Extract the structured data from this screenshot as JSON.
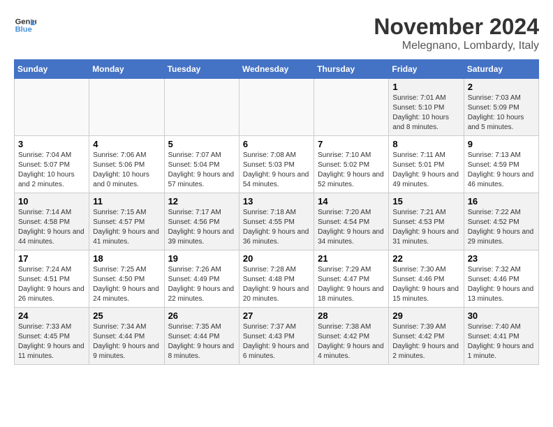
{
  "logo": {
    "line1": "General",
    "line2": "Blue"
  },
  "title": "November 2024",
  "location": "Melegnano, Lombardy, Italy",
  "weekdays": [
    "Sunday",
    "Monday",
    "Tuesday",
    "Wednesday",
    "Thursday",
    "Friday",
    "Saturday"
  ],
  "weeks": [
    [
      {
        "day": "",
        "info": ""
      },
      {
        "day": "",
        "info": ""
      },
      {
        "day": "",
        "info": ""
      },
      {
        "day": "",
        "info": ""
      },
      {
        "day": "",
        "info": ""
      },
      {
        "day": "1",
        "info": "Sunrise: 7:01 AM\nSunset: 5:10 PM\nDaylight: 10 hours and 8 minutes."
      },
      {
        "day": "2",
        "info": "Sunrise: 7:03 AM\nSunset: 5:09 PM\nDaylight: 10 hours and 5 minutes."
      }
    ],
    [
      {
        "day": "3",
        "info": "Sunrise: 7:04 AM\nSunset: 5:07 PM\nDaylight: 10 hours and 2 minutes."
      },
      {
        "day": "4",
        "info": "Sunrise: 7:06 AM\nSunset: 5:06 PM\nDaylight: 10 hours and 0 minutes."
      },
      {
        "day": "5",
        "info": "Sunrise: 7:07 AM\nSunset: 5:04 PM\nDaylight: 9 hours and 57 minutes."
      },
      {
        "day": "6",
        "info": "Sunrise: 7:08 AM\nSunset: 5:03 PM\nDaylight: 9 hours and 54 minutes."
      },
      {
        "day": "7",
        "info": "Sunrise: 7:10 AM\nSunset: 5:02 PM\nDaylight: 9 hours and 52 minutes."
      },
      {
        "day": "8",
        "info": "Sunrise: 7:11 AM\nSunset: 5:01 PM\nDaylight: 9 hours and 49 minutes."
      },
      {
        "day": "9",
        "info": "Sunrise: 7:13 AM\nSunset: 4:59 PM\nDaylight: 9 hours and 46 minutes."
      }
    ],
    [
      {
        "day": "10",
        "info": "Sunrise: 7:14 AM\nSunset: 4:58 PM\nDaylight: 9 hours and 44 minutes."
      },
      {
        "day": "11",
        "info": "Sunrise: 7:15 AM\nSunset: 4:57 PM\nDaylight: 9 hours and 41 minutes."
      },
      {
        "day": "12",
        "info": "Sunrise: 7:17 AM\nSunset: 4:56 PM\nDaylight: 9 hours and 39 minutes."
      },
      {
        "day": "13",
        "info": "Sunrise: 7:18 AM\nSunset: 4:55 PM\nDaylight: 9 hours and 36 minutes."
      },
      {
        "day": "14",
        "info": "Sunrise: 7:20 AM\nSunset: 4:54 PM\nDaylight: 9 hours and 34 minutes."
      },
      {
        "day": "15",
        "info": "Sunrise: 7:21 AM\nSunset: 4:53 PM\nDaylight: 9 hours and 31 minutes."
      },
      {
        "day": "16",
        "info": "Sunrise: 7:22 AM\nSunset: 4:52 PM\nDaylight: 9 hours and 29 minutes."
      }
    ],
    [
      {
        "day": "17",
        "info": "Sunrise: 7:24 AM\nSunset: 4:51 PM\nDaylight: 9 hours and 26 minutes."
      },
      {
        "day": "18",
        "info": "Sunrise: 7:25 AM\nSunset: 4:50 PM\nDaylight: 9 hours and 24 minutes."
      },
      {
        "day": "19",
        "info": "Sunrise: 7:26 AM\nSunset: 4:49 PM\nDaylight: 9 hours and 22 minutes."
      },
      {
        "day": "20",
        "info": "Sunrise: 7:28 AM\nSunset: 4:48 PM\nDaylight: 9 hours and 20 minutes."
      },
      {
        "day": "21",
        "info": "Sunrise: 7:29 AM\nSunset: 4:47 PM\nDaylight: 9 hours and 18 minutes."
      },
      {
        "day": "22",
        "info": "Sunrise: 7:30 AM\nSunset: 4:46 PM\nDaylight: 9 hours and 15 minutes."
      },
      {
        "day": "23",
        "info": "Sunrise: 7:32 AM\nSunset: 4:46 PM\nDaylight: 9 hours and 13 minutes."
      }
    ],
    [
      {
        "day": "24",
        "info": "Sunrise: 7:33 AM\nSunset: 4:45 PM\nDaylight: 9 hours and 11 minutes."
      },
      {
        "day": "25",
        "info": "Sunrise: 7:34 AM\nSunset: 4:44 PM\nDaylight: 9 hours and 9 minutes."
      },
      {
        "day": "26",
        "info": "Sunrise: 7:35 AM\nSunset: 4:44 PM\nDaylight: 9 hours and 8 minutes."
      },
      {
        "day": "27",
        "info": "Sunrise: 7:37 AM\nSunset: 4:43 PM\nDaylight: 9 hours and 6 minutes."
      },
      {
        "day": "28",
        "info": "Sunrise: 7:38 AM\nSunset: 4:42 PM\nDaylight: 9 hours and 4 minutes."
      },
      {
        "day": "29",
        "info": "Sunrise: 7:39 AM\nSunset: 4:42 PM\nDaylight: 9 hours and 2 minutes."
      },
      {
        "day": "30",
        "info": "Sunrise: 7:40 AM\nSunset: 4:41 PM\nDaylight: 9 hours and 1 minute."
      }
    ]
  ]
}
